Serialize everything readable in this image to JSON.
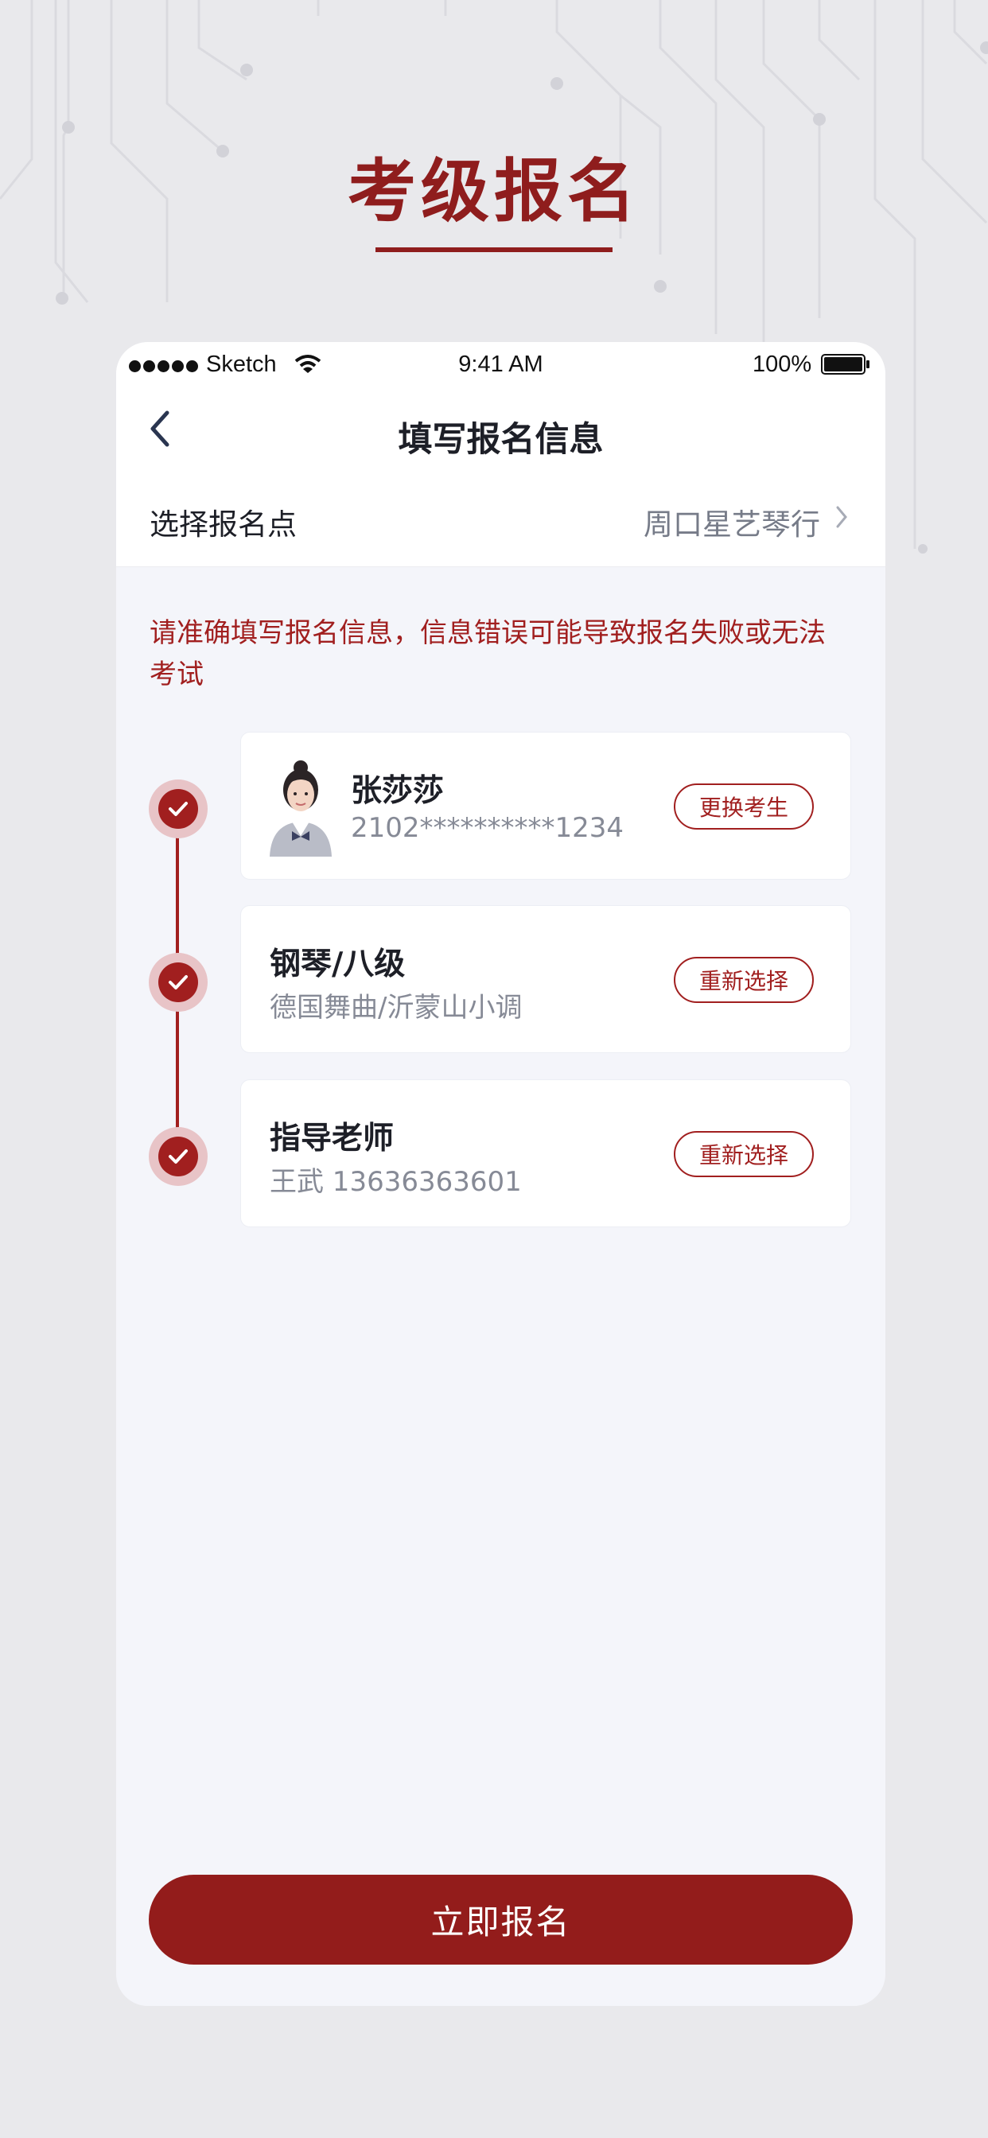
{
  "poster": {
    "title": "考级报名"
  },
  "status_bar": {
    "carrier": "Sketch",
    "time": "9:41 AM",
    "battery": "100%"
  },
  "nav": {
    "title": "填写报名信息",
    "back_icon": "chevron-left-icon"
  },
  "location": {
    "label": "选择报名点",
    "value": "周口星艺琴行"
  },
  "warning": "请准确填写报名信息，信息错误可能导致报名失败或无法考试",
  "cards": [
    {
      "title": "张莎莎",
      "subtitle": "2102**********1234",
      "button": "更换考生"
    },
    {
      "title": "钢琴/八级",
      "subtitle": "德国舞曲/沂蒙山小调",
      "button": "重新选择"
    },
    {
      "title": "指导老师",
      "subtitle": "王武 13636363601",
      "button": "重新选择"
    }
  ],
  "submit": {
    "label": "立即报名"
  },
  "colors": {
    "accent": "#931c1b",
    "background": "#e9e9ec",
    "panel": "#f4f5fa"
  }
}
